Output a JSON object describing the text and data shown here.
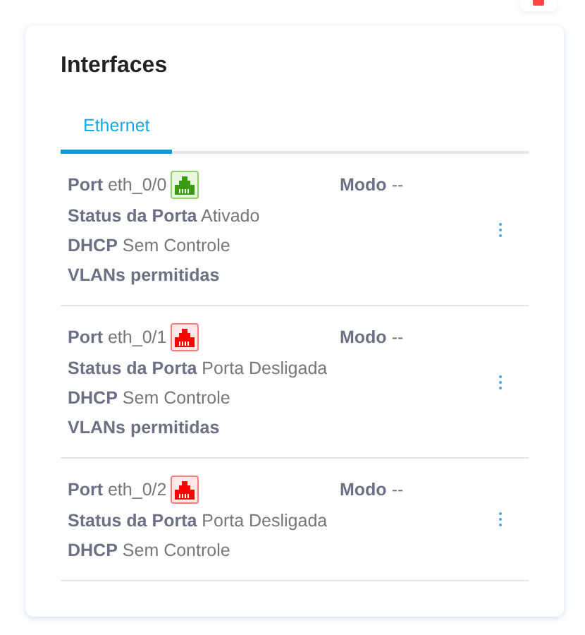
{
  "title": "Interfaces",
  "tabs": [
    {
      "label": "Ethernet",
      "selected": true
    }
  ],
  "ports": [
    {
      "port_label": "Port",
      "port": "eth_0/0",
      "up": true,
      "mode_label": "Modo",
      "mode": "--",
      "status_label": "Status da Porta",
      "status": "Ativado",
      "dhcp_label": "DHCP",
      "dhcp": "Sem Controle",
      "vlans_label": "VLANs permitidas"
    },
    {
      "port_label": "Port",
      "port": "eth_0/1",
      "up": false,
      "mode_label": "Modo",
      "mode": "--",
      "status_label": "Status da Porta",
      "status": "Porta Desligada",
      "dhcp_label": "DHCP",
      "dhcp": "Sem Controle",
      "vlans_label": "VLANs permitidas"
    },
    {
      "port_label": "Port",
      "port": "eth_0/2",
      "up": false,
      "mode_label": "Modo",
      "mode": "--",
      "status_label": "Status da Porta",
      "status": "Porta Desligada",
      "dhcp_label": "DHCP",
      "dhcp": "Sem Controle"
    }
  ]
}
